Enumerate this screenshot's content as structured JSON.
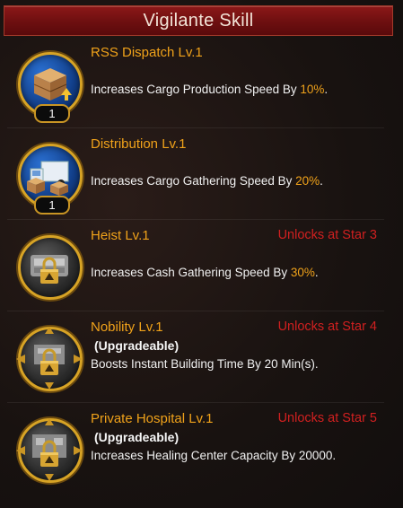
{
  "header": {
    "title": "Vigilante Skill"
  },
  "skills": [
    {
      "title": "RSS Dispatch Lv.1",
      "unlock": "",
      "upgradeable": "",
      "desc_pre": "Increases Cargo Production Speed By ",
      "desc_val": "10%",
      "desc_post": ".",
      "level_badge": "1",
      "icon": "cargo-crate-icon"
    },
    {
      "title": "Distribution Lv.1",
      "unlock": "",
      "upgradeable": "",
      "desc_pre": "Increases Cargo Gathering Speed By ",
      "desc_val": "20%",
      "desc_post": ".",
      "level_badge": "1",
      "icon": "delivery-truck-icon"
    },
    {
      "title": "Heist Lv.1",
      "unlock": "Unlocks at Star 3",
      "upgradeable": "",
      "desc_pre": "Increases Cash Gathering Speed By ",
      "desc_val": "30%",
      "desc_post": ".",
      "level_badge": "",
      "icon": "locked-heist-icon"
    },
    {
      "title": "Nobility Lv.1",
      "unlock": "Unlocks at Star 4",
      "upgradeable": "(Upgradeable)",
      "desc_pre": "Boosts Instant Building Time By ",
      "desc_val": "20",
      "desc_post": " Min(s).",
      "level_badge": "",
      "icon": "locked-nobility-icon"
    },
    {
      "title": "Private Hospital Lv.1",
      "unlock": "Unlocks at Star 5",
      "upgradeable": "(Upgradeable)",
      "desc_pre": "Increases Healing Center Capacity By ",
      "desc_val": "20000",
      "desc_post": ".",
      "level_badge": "",
      "icon": "locked-hospital-icon"
    }
  ],
  "colors": {
    "title": "#f0a21a",
    "unlock": "#d02020",
    "header_bg": "#7a1212",
    "badge_gold": "#d7a325"
  }
}
